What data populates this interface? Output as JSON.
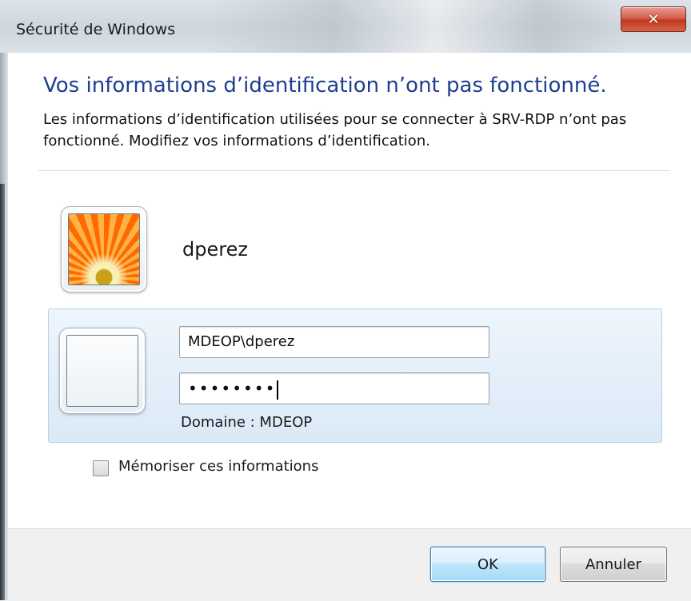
{
  "window": {
    "title": "Sécurité de Windows",
    "close_icon": "close-icon"
  },
  "message": {
    "heading": "Vos informations d’identification n’ont pas fonctionné.",
    "description": "Les informations d’identification utilisées pour se connecter à SRV-RDP n’ont pas fonctionné. Modifiez vos informations d’identification."
  },
  "account": {
    "username": "dperez",
    "avatar": "flower-avatar-icon"
  },
  "credentials": {
    "avatar": "blank-avatar-icon",
    "user_value": "MDEOP\\dperez",
    "password_value": "••••••••",
    "domain_label": "Domaine : MDEOP"
  },
  "options": {
    "remember_label": "Mémoriser ces informations",
    "remember_checked": false
  },
  "buttons": {
    "ok_label": "OK",
    "cancel_label": "Annuler"
  },
  "colors": {
    "heading": "#1e3e8f",
    "close_button": "#c2391f",
    "panel_background": "#dbe9f7"
  }
}
